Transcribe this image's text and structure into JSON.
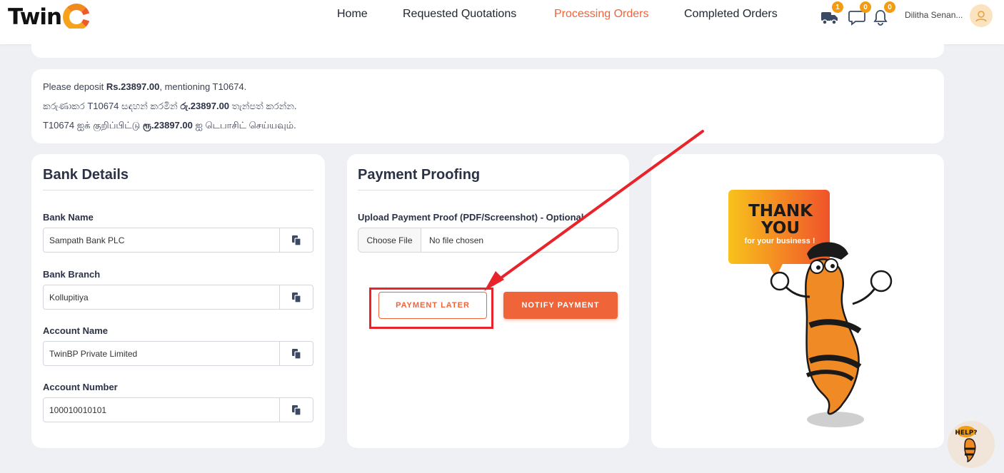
{
  "header": {
    "logo_text": "Twin",
    "nav": {
      "home": "Home",
      "requested": "Requested Quotations",
      "processing": "Processing Orders",
      "completed": "Completed Orders"
    },
    "badges": {
      "truck": "1",
      "chat": "0",
      "bell": "0"
    },
    "user_name": "Dilitha Senan...",
    "colors": {
      "accent": "#f0643a",
      "badge": "#f39c12"
    }
  },
  "deposit": {
    "line1": {
      "pre": "Please deposit ",
      "amount": "Rs.23897.00",
      "post": ", mentioning T10674."
    },
    "line2": {
      "pre": "කරුණාකර T10674 සඳහන් කරමින් ",
      "amount": "රු.23897.00",
      "post": " තැන්පත් කරන්න."
    },
    "line3": {
      "pre": "T10674 ஐக் குறிப்பிட்டு ",
      "amount": "ரூ.23897.00",
      "post": " ஐ டெபாசிட் செய்யவும்."
    }
  },
  "bank": {
    "title": "Bank Details",
    "fields": [
      {
        "label": "Bank Name",
        "value": "Sampath Bank PLC"
      },
      {
        "label": "Bank Branch",
        "value": "Kollupitiya"
      },
      {
        "label": "Account Name",
        "value": "TwinBP Private Limited"
      },
      {
        "label": "Account Number",
        "value": "100010010101"
      }
    ]
  },
  "proof": {
    "title": "Payment Proofing",
    "upload_label": "Upload Payment Proof (PDF/Screenshot) - Optional",
    "choose_file": "Choose File",
    "no_file": "No file chosen",
    "btn_later": "PAYMENT LATER",
    "btn_notify": "NOTIFY PAYMENT"
  },
  "thanks": {
    "line1": "THANK",
    "line2": "YOU",
    "line3": "for your business !"
  },
  "help": {
    "label": "HELP?"
  }
}
